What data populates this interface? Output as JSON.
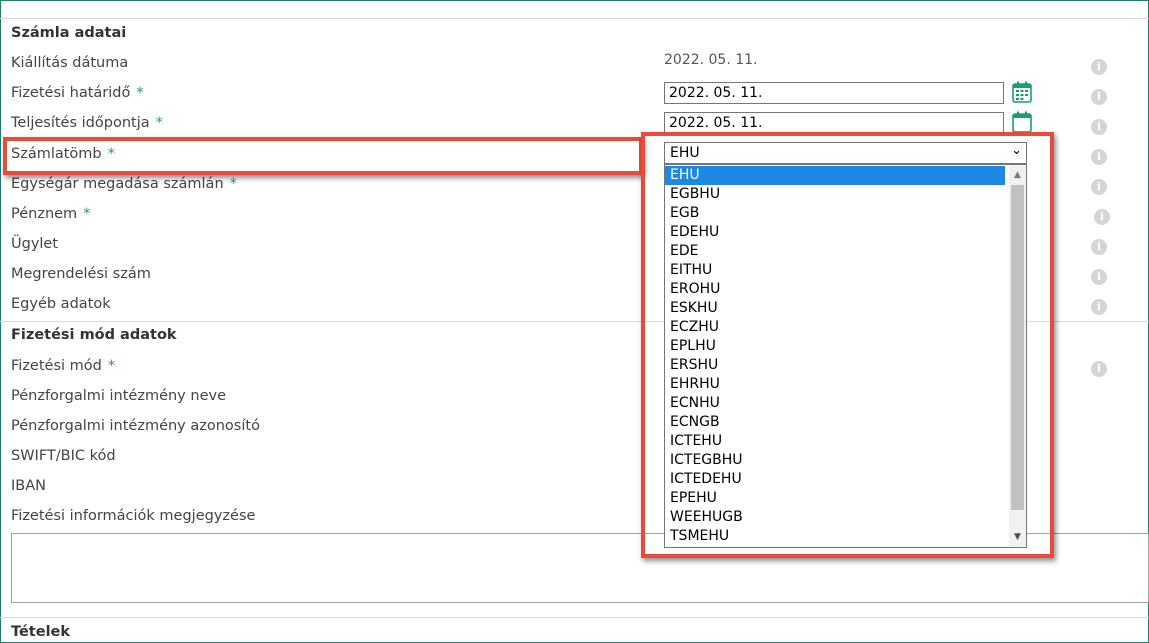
{
  "sections": {
    "invoice": "Számla adatai",
    "payment": "Fizetési mód adatok",
    "items": "Tételek"
  },
  "fields": {
    "issue_date_label": "Kiállítás dátuma",
    "issue_date_value": "2022. 05. 11.",
    "due_date_label": "Fizetési határidő",
    "due_date_value": "2022. 05. 11.",
    "completion_label": "Teljesítés időpontja",
    "completion_value": "2022. 05. 11.",
    "invoice_block_label": "Számlatömb",
    "unit_price_label": "Egységár megadása számlán",
    "currency_label": "Pénznem",
    "transaction_label": "Ügylet",
    "order_number_label": "Megrendelési szám",
    "other_data_label": "Egyéb adatok",
    "payment_method_label": "Fizetési mód",
    "bank_name_label": "Pénzforgalmi intézmény neve",
    "bank_id_label": "Pénzforgalmi intézmény azonosító",
    "swift_label": "SWIFT/BIC kód",
    "iban_label": "IBAN",
    "payment_note_label": "Fizetési információk megjegyzése"
  },
  "required_mark": "*",
  "info_glyph": "i",
  "select": {
    "selected": "EHU",
    "options": [
      "EHU",
      "EGBHU",
      "EGB",
      "EDEHU",
      "EDE",
      "EITHU",
      "EROHU",
      "ESKHU",
      "ECZHU",
      "EPLHU",
      "ERSHU",
      "EHRHU",
      "ECNHU",
      "ECNGB",
      "ICTEHU",
      "ICTEGBHU",
      "ICTEDEHU",
      "EPEHU",
      "WEEHUGB",
      "TSMEHU"
    ]
  },
  "colors": {
    "accent": "#1a9e6a",
    "highlight": "#e84b3c",
    "selected_option": "#1e88e5"
  }
}
